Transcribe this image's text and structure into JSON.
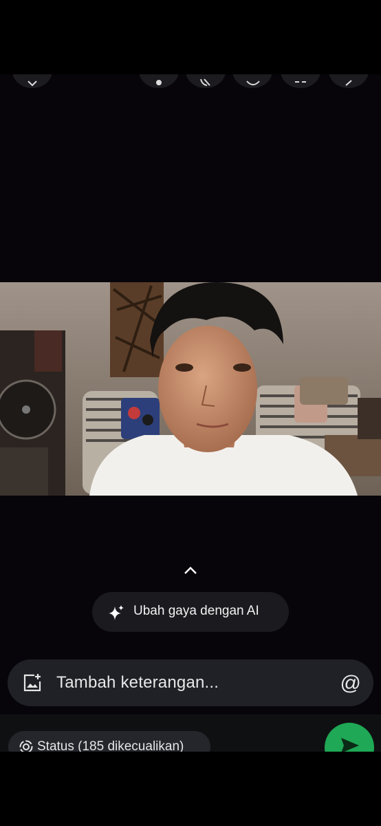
{
  "editor": {
    "ai_style_label": "Ubah gaya dengan AI",
    "caption_placeholder": "Tambah keterangan...",
    "mention_symbol": "@",
    "status_label": "Status (185 dikecualikan)"
  },
  "icons": {
    "toolbar": [
      "back-icon",
      "music-icon",
      "crop-rotate-icon",
      "view-once-icon",
      "text-icon",
      "pencil-icon"
    ],
    "expand": "chevron-up-icon",
    "ai": "sparkle-icon",
    "caption": "add-image-icon",
    "status": "status-ring-icon",
    "send": "send-icon"
  },
  "colors": {
    "background": "#07050a",
    "pill": "#1a1a1f",
    "caption_bar": "#1f2126",
    "send": "#1fa855"
  }
}
